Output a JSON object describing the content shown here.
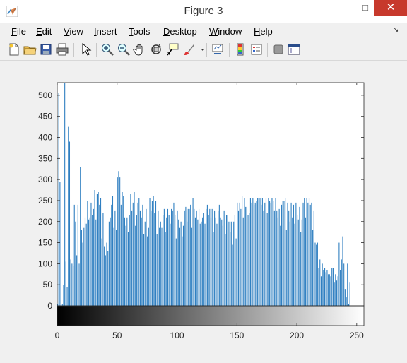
{
  "window": {
    "title": "Figure 3",
    "minimize_label": "—",
    "maximize_label": "□",
    "close_label": "✕"
  },
  "menu": [
    "File",
    "Edit",
    "View",
    "Insert",
    "Tools",
    "Desktop",
    "Window",
    "Help"
  ],
  "toolbar_icons": [
    "new-figure-icon",
    "open-file-icon",
    "save-icon",
    "print-icon",
    "pointer-icon",
    "zoom-in-icon",
    "zoom-out-icon",
    "pan-hand-icon",
    "rotate-3d-icon",
    "data-cursor-icon",
    "brush-icon",
    "link-plot-icon",
    "colorbar-icon",
    "legend-icon",
    "hide-plot-tools-icon",
    "show-plot-tools-icon"
  ],
  "colors": {
    "bar": "#2f7fc1",
    "axis": "#262626",
    "close": "#c7392c"
  },
  "chart_data": {
    "type": "bar",
    "title": "",
    "xlabel": "",
    "ylabel": "",
    "xlim": [
      0,
      256
    ],
    "ylim": [
      0,
      530
    ],
    "xticks": [
      0,
      50,
      100,
      150,
      200,
      250
    ],
    "yticks": [
      0,
      50,
      100,
      150,
      200,
      250,
      300,
      350,
      400,
      450,
      500
    ],
    "colorbar": "grayscale gradient 0 to 255 below x axis",
    "x_start": 0,
    "values": [
      5,
      505,
      295,
      0,
      5,
      50,
      530,
      105,
      45,
      425,
      390,
      110,
      100,
      95,
      240,
      200,
      120,
      240,
      100,
      330,
      180,
      150,
      185,
      210,
      195,
      250,
      205,
      210,
      245,
      215,
      230,
      275,
      205,
      265,
      270,
      240,
      255,
      160,
      220,
      140,
      120,
      150,
      130,
      200,
      210,
      240,
      260,
      185,
      225,
      180,
      305,
      320,
      305,
      240,
      270,
      260,
      210,
      190,
      210,
      175,
      215,
      265,
      225,
      245,
      270,
      190,
      215,
      245,
      255,
      225,
      210,
      240,
      170,
      200,
      230,
      165,
      185,
      255,
      225,
      250,
      260,
      220,
      250,
      170,
      225,
      185,
      200,
      185,
      215,
      230,
      175,
      210,
      230,
      215,
      195,
      230,
      225,
      245,
      215,
      160,
      225,
      205,
      185,
      200,
      165,
      190,
      225,
      235,
      200,
      230,
      230,
      240,
      185,
      255,
      230,
      210,
      225,
      205,
      230,
      195,
      200,
      210,
      220,
      195,
      230,
      240,
      215,
      230,
      210,
      230,
      175,
      225,
      210,
      195,
      225,
      240,
      210,
      205,
      190,
      225,
      170,
      215,
      215,
      200,
      175,
      200,
      145,
      200,
      215,
      160,
      245,
      225,
      245,
      230,
      260,
      210,
      255,
      235,
      235,
      215,
      220,
      255,
      245,
      255,
      240,
      245,
      250,
      255,
      255,
      255,
      240,
      255,
      225,
      245,
      255,
      220,
      255,
      250,
      245,
      255,
      250,
      225,
      255,
      225,
      210,
      230,
      190,
      240,
      250,
      250,
      255,
      180,
      245,
      225,
      200,
      245,
      210,
      240,
      195,
      245,
      215,
      205,
      235,
      175,
      205,
      245,
      255,
      210,
      255,
      245,
      255,
      240,
      245,
      180,
      225,
      150,
      145,
      150,
      90,
      110,
      70,
      100,
      85,
      90,
      80,
      85,
      75,
      75,
      70,
      90,
      90,
      55,
      75,
      60,
      70,
      150,
      85,
      110,
      165,
      100,
      40,
      20,
      100,
      5,
      55
    ]
  }
}
